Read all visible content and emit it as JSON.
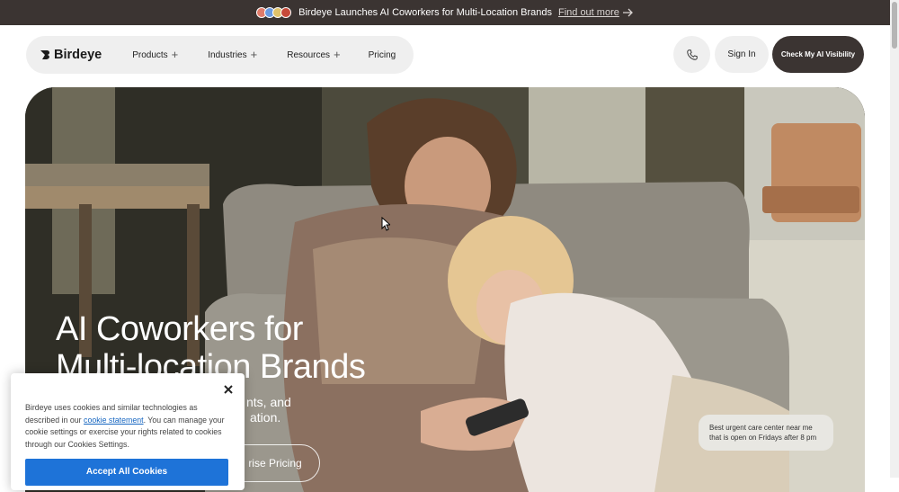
{
  "announcement": {
    "text": "Birdeye Launches AI Coworkers for Multi-Location Brands",
    "link": "Find out more",
    "icons": [
      "arrow-right-icon"
    ]
  },
  "nav": {
    "logo": "Birdeye",
    "items": [
      {
        "label": "Products",
        "has_submenu": true
      },
      {
        "label": "Industries",
        "has_submenu": true
      },
      {
        "label": "Resources",
        "has_submenu": true
      },
      {
        "label": "Pricing",
        "has_submenu": false
      }
    ],
    "submenu_glyph": "+",
    "phone_icon": "phone-icon",
    "sign_in": "Sign In",
    "cta": "Check My AI Visibility"
  },
  "hero": {
    "title_line1": "AI Coworkers for",
    "title_line2": "Multi-location Brands",
    "subtitle_line1": "nts, and",
    "subtitle_line2": "ation.",
    "button": "rise Pricing"
  },
  "chat": {
    "line1": "Best urgent care center near me",
    "line2": "that is open on Fridays after 8 pm"
  },
  "cookie": {
    "text_1": "Birdeye uses cookies and similar technologies as described in our ",
    "statement_link": "cookie statement",
    "text_2": ". You can manage your cookie settings or exercise your rights related to cookies through our Cookies Settings.",
    "accept": "Accept All Cookies"
  },
  "colors": {
    "dark_brand": "#3b3432",
    "pill_bg": "#efefef",
    "accept_blue": "#1e73d8",
    "link_blue": "#1565c0"
  }
}
